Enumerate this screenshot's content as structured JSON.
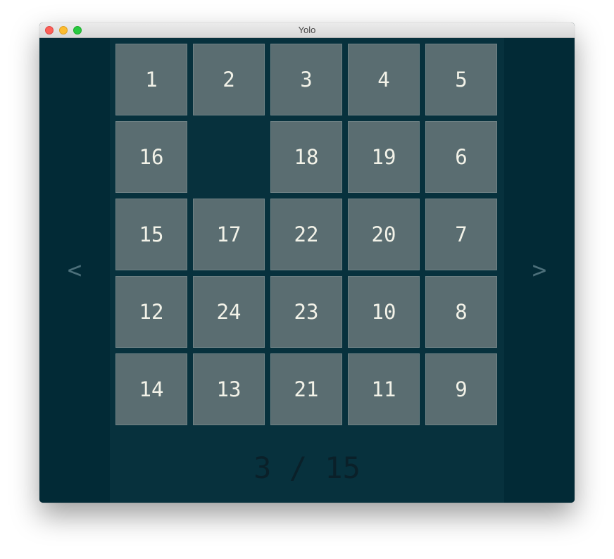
{
  "window": {
    "title": "Yolo"
  },
  "nav": {
    "prev": "<",
    "next": ">"
  },
  "board": {
    "rows": [
      [
        "1",
        "2",
        "3",
        "4",
        "5"
      ],
      [
        "16",
        "",
        "18",
        "19",
        "6"
      ],
      [
        "15",
        "17",
        "22",
        "20",
        "7"
      ],
      [
        "12",
        "24",
        "23",
        "10",
        "8"
      ],
      [
        "14",
        "13",
        "21",
        "11",
        "9"
      ]
    ]
  },
  "counter": {
    "text": "3 / 15"
  },
  "colors": {
    "background": "#022a36",
    "board_background": "#07313d",
    "tile": "#5a6d71",
    "tile_text": "#f2f2e8",
    "arrow": "#4c6f7a",
    "counter_text": "#0a2029"
  }
}
